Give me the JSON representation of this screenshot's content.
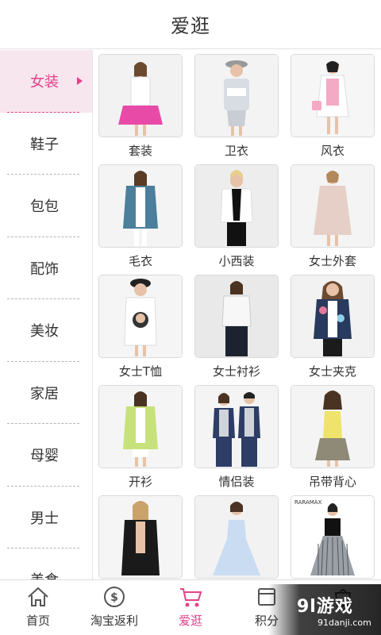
{
  "header": {
    "title": "爱逛"
  },
  "sidebar": {
    "items": [
      {
        "label": "女装",
        "active": true
      },
      {
        "label": "鞋子"
      },
      {
        "label": "包包"
      },
      {
        "label": "配饰"
      },
      {
        "label": "美妆"
      },
      {
        "label": "家居"
      },
      {
        "label": "母婴"
      },
      {
        "label": "男士"
      },
      {
        "label": "美食"
      }
    ]
  },
  "grid": {
    "items": [
      {
        "label": "套装"
      },
      {
        "label": "卫衣"
      },
      {
        "label": "风衣"
      },
      {
        "label": "毛衣"
      },
      {
        "label": "小西装"
      },
      {
        "label": "女士外套"
      },
      {
        "label": "女士T恤"
      },
      {
        "label": "女士衬衫"
      },
      {
        "label": "女士夹克"
      },
      {
        "label": "开衫"
      },
      {
        "label": "情侣装"
      },
      {
        "label": "吊带背心"
      },
      {
        "label": ""
      },
      {
        "label": ""
      },
      {
        "label": ""
      }
    ],
    "last_row_brand_text": "RARAMAX"
  },
  "tabbar": {
    "tabs": [
      {
        "label": "首页",
        "icon": "home-icon"
      },
      {
        "label": "淘宝返利",
        "icon": "dollar-coin-icon"
      },
      {
        "label": "爱逛",
        "icon": "shopping-cart-icon",
        "active": true
      },
      {
        "label": "积分",
        "icon": "points-icon"
      },
      {
        "label": "",
        "icon": "bag-icon"
      }
    ]
  },
  "watermark": {
    "main": "9l游戏",
    "url": "91danji.com"
  },
  "colors": {
    "accent": "#e2428a",
    "sidebar_active_bg": "#f7e6ee",
    "text": "#333333"
  }
}
